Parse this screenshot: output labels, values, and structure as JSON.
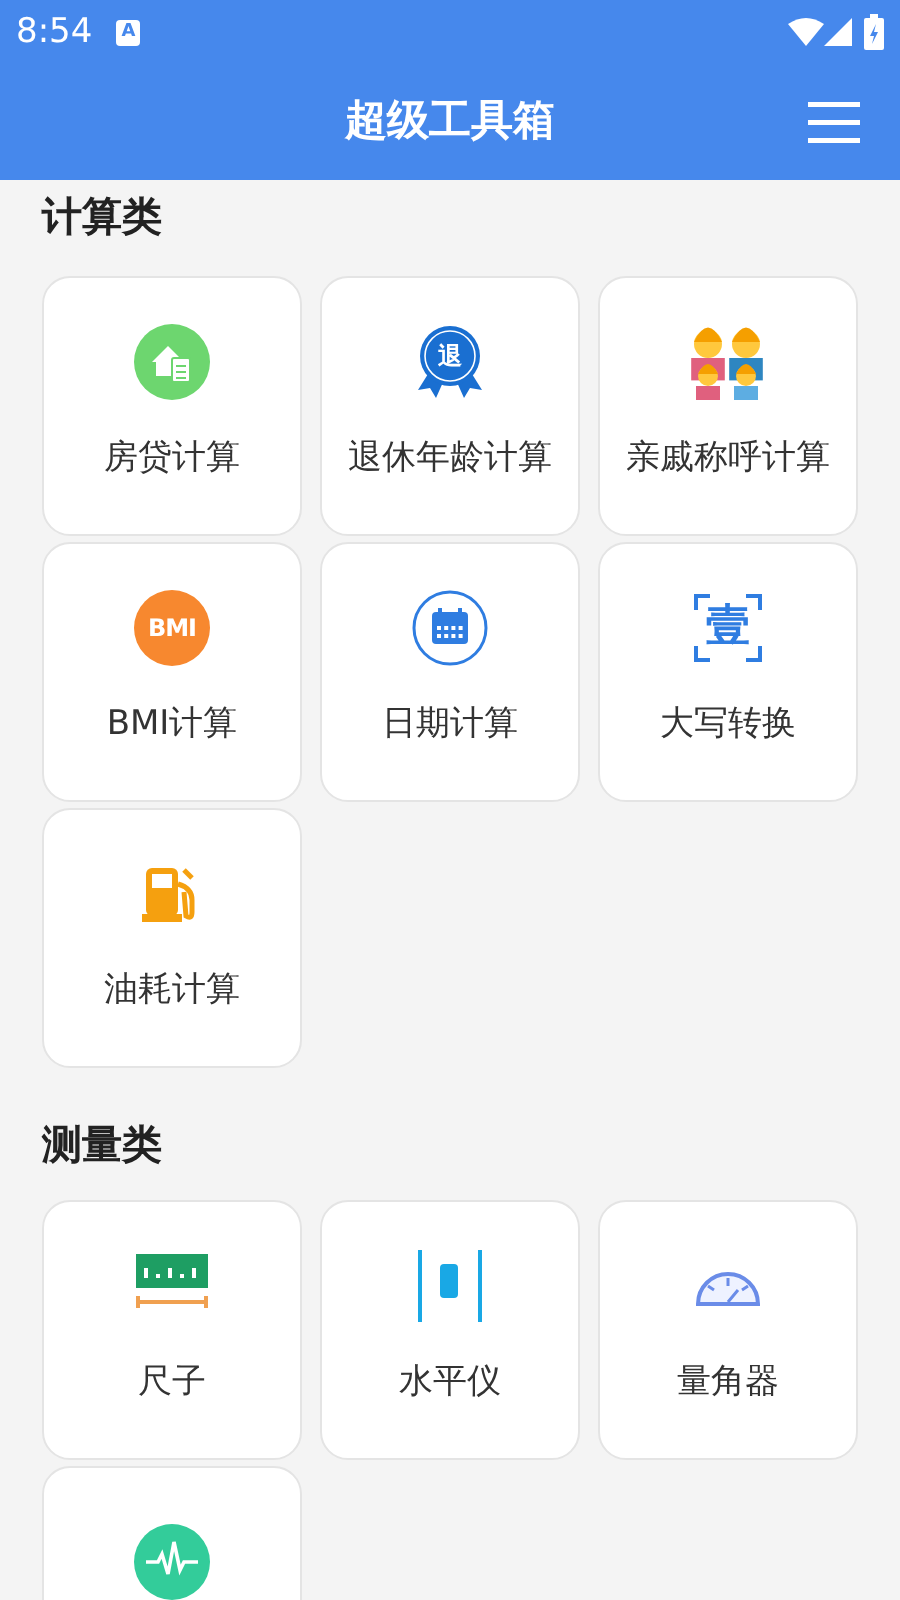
{
  "status_bar": {
    "time": "8:54",
    "notification_icon_text": "A"
  },
  "app_bar": {
    "title": "超级工具箱"
  },
  "sections": [
    {
      "title": "计算类",
      "items": [
        {
          "kind": "labeled",
          "label": "房贷计算"
        },
        {
          "kind": "labeled",
          "label": "退休年龄计算",
          "icon_text": "退"
        },
        {
          "kind": "labeled",
          "label": "亲戚称呼计算"
        },
        {
          "kind": "labeled",
          "label": "BMI计算",
          "icon_text": "BMI"
        },
        {
          "kind": "labeled",
          "label": "日期计算"
        },
        {
          "kind": "labeled",
          "label": "大写转换",
          "icon_text": "壹"
        },
        {
          "kind": "labeled",
          "label": "油耗计算"
        }
      ]
    },
    {
      "title": "测量类",
      "items": [
        {
          "kind": "labeled",
          "label": "尺子"
        },
        {
          "kind": "labeled",
          "label": "水平仪"
        },
        {
          "kind": "labeled",
          "label": "量角器"
        },
        {
          "kind": "icon_only"
        }
      ]
    }
  ]
}
